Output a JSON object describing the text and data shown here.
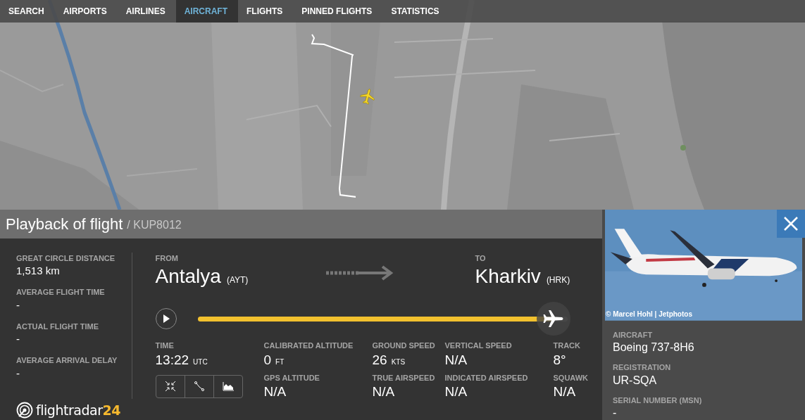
{
  "nav": [
    {
      "label": "SEARCH",
      "selected": false
    },
    {
      "label": "AIRPORTS",
      "selected": false
    },
    {
      "label": "AIRLINES",
      "selected": false
    },
    {
      "label": "AIRCRAFT",
      "selected": true
    },
    {
      "label": "FLIGHTS",
      "selected": false
    },
    {
      "label": "PINNED FLIGHTS",
      "selected": false
    },
    {
      "label": "STATISTICS",
      "selected": false
    }
  ],
  "playback": {
    "title": "Playback of flight",
    "flight": "/ KUP8012"
  },
  "stats": [
    {
      "label": "GREAT CIRCLE DISTANCE",
      "value": "1,513 km"
    },
    {
      "label": "AVERAGE FLIGHT TIME",
      "value": "-"
    },
    {
      "label": "ACTUAL FLIGHT TIME",
      "value": "-"
    },
    {
      "label": "AVERAGE ARRIVAL DELAY",
      "value": "-"
    }
  ],
  "logo": {
    "name": "flightradar",
    "number": "24"
  },
  "route": {
    "from": {
      "label": "FROM",
      "city": "Antalya",
      "code": "(AYT)"
    },
    "to": {
      "label": "TO",
      "city": "Kharkiv",
      "code": "(HRK)"
    }
  },
  "progress": {
    "level": 0.96
  },
  "time": {
    "label": "TIME",
    "value": "13:22",
    "unit": "UTC"
  },
  "readings": [
    {
      "label": "CALIBRATED ALTITUDE",
      "value": "0",
      "unit": "FT"
    },
    {
      "label": "GROUND SPEED",
      "value": "26",
      "unit": "KTS"
    },
    {
      "label": "VERTICAL SPEED",
      "value": "N/A"
    },
    {
      "label": "TRACK",
      "value": "8°"
    },
    {
      "label": "GPS ALTITUDE",
      "value": "N/A"
    },
    {
      "label": "TRUE AIRSPEED",
      "value": "N/A"
    },
    {
      "label": "INDICATED AIRSPEED",
      "value": "N/A"
    },
    {
      "label": "SQUAWK",
      "value": "N/A"
    }
  ],
  "photo": {
    "kind": "picture",
    "credit": "© Marcel Hohl | Jetphotos"
  },
  "aircraft_info": [
    {
      "label": "AIRCRAFT",
      "value": "Boeing 737-8H6"
    },
    {
      "label": "REGISTRATION",
      "value": "UR-SQA"
    },
    {
      "label": "SERIAL NUMBER (MSN)",
      "value": "-"
    }
  ]
}
